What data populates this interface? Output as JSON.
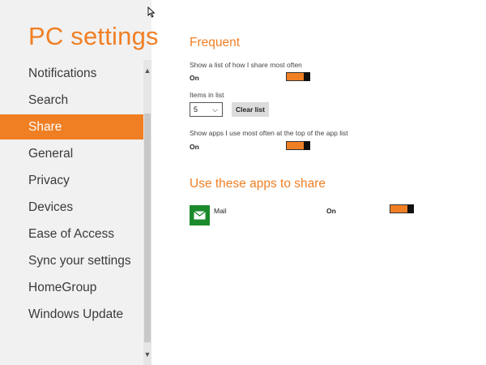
{
  "nav": {
    "title": "PC settings",
    "items": [
      {
        "label": "Notifications"
      },
      {
        "label": "Search"
      },
      {
        "label": "Share"
      },
      {
        "label": "General"
      },
      {
        "label": "Privacy"
      },
      {
        "label": "Devices"
      },
      {
        "label": "Ease of Access"
      },
      {
        "label": "Sync your settings"
      },
      {
        "label": "HomeGroup"
      },
      {
        "label": "Windows Update"
      }
    ],
    "selected": "Share"
  },
  "frequent": {
    "title": "Frequent",
    "share_often_label": "Show a list of how I share most often",
    "share_often_state": "On",
    "items_label": "Items in list",
    "items_value": "5",
    "clear_label": "Clear list",
    "apps_top_label": "Show apps I use most often at the top of the app list",
    "apps_top_state": "On"
  },
  "apps": {
    "title": "Use these apps to share",
    "list": [
      {
        "name": "Mail",
        "state": "On",
        "icon": "mail-icon"
      }
    ]
  },
  "colors": {
    "accent": "#f07f24",
    "mail_tile": "#1b8a2c"
  }
}
